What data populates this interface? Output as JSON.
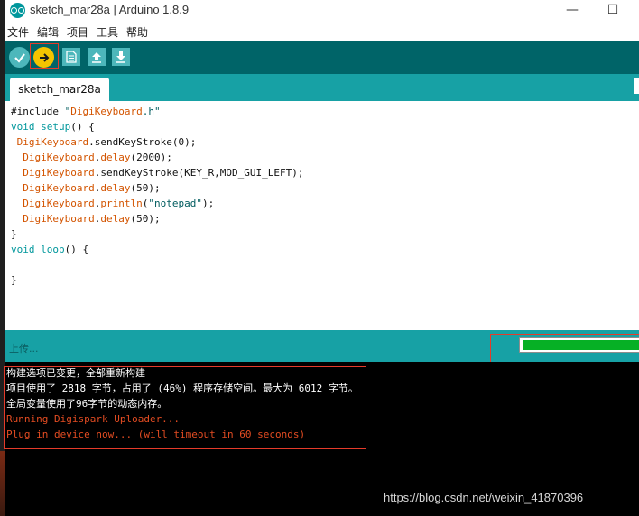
{
  "window": {
    "title": "sketch_mar28a | Arduino 1.8.9",
    "minimize_symbol": "—",
    "maximize_symbol": "☐"
  },
  "menu": [
    "文件",
    "编辑",
    "项目",
    "工具",
    "帮助"
  ],
  "toolbar": {
    "verify_icon": "check-icon",
    "upload_icon": "arrow-right-icon",
    "new_icon": "file-icon",
    "open_icon": "arrow-up-icon",
    "save_icon": "arrow-down-icon",
    "accent": "#006468",
    "upload_color": "#f4c400"
  },
  "tab": {
    "label": "sketch_mar28a"
  },
  "code": [
    {
      "text": "#include \"DigiKeyboard.h\""
    },
    {
      "text": "void setup() {"
    },
    {
      "text": " DigiKeyboard.sendKeyStroke(0);"
    },
    {
      "text": "  DigiKeyboard.delay(2000);"
    },
    {
      "text": "  DigiKeyboard.sendKeyStroke(KEY_R,MOD_GUI_LEFT);"
    },
    {
      "text": "  DigiKeyboard.delay(50);"
    },
    {
      "text": "  DigiKeyboard.println(\"notepad\");"
    },
    {
      "text": "  DigiKeyboard.delay(50);"
    },
    {
      "text": "}"
    },
    {
      "text": "void loop() {"
    },
    {
      "text": ""
    },
    {
      "text": "}"
    }
  ],
  "status": {
    "text": "上传...",
    "progress_fraction": 0.95,
    "progress_color": "#06b025"
  },
  "console": [
    {
      "text": "构建选项已变更，全部重新构建",
      "color": "white"
    },
    {
      "text": "项目使用了 2818 字节，占用了 (46%) 程序存储空间。最大为 6012 字节。",
      "color": "white"
    },
    {
      "text": "全局变量使用了96字节的动态内存。",
      "color": "white"
    },
    {
      "text": "Running Digispark Uploader...",
      "color": "red"
    },
    {
      "text": "Plug in device now... (will timeout in 60 seconds)",
      "color": "red"
    }
  ],
  "watermark": "https://blog.csdn.net/weixin_41870396"
}
